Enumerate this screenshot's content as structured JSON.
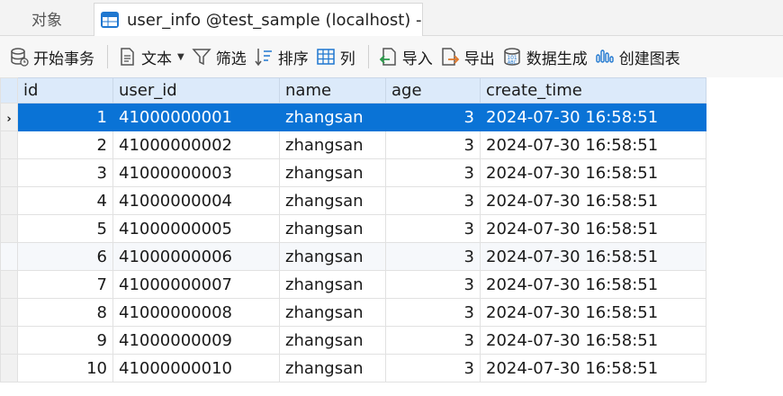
{
  "tabs": {
    "objects_label": "对象",
    "table_tab_label": "user_info @test_sample (localhost) -..."
  },
  "toolbar": {
    "begin_transaction": "开始事务",
    "text": "文本",
    "filter": "筛选",
    "sort": "排序",
    "columns": "列",
    "import": "导入",
    "export": "导出",
    "data_generation": "数据生成",
    "create_chart": "创建图表"
  },
  "grid": {
    "columns": [
      "id",
      "user_id",
      "name",
      "age",
      "create_time"
    ],
    "rows": [
      [
        "1",
        "41000000001",
        "zhangsan",
        "3",
        "2024-07-30 16:58:51"
      ],
      [
        "2",
        "41000000002",
        "zhangsan",
        "3",
        "2024-07-30 16:58:51"
      ],
      [
        "3",
        "41000000003",
        "zhangsan",
        "3",
        "2024-07-30 16:58:51"
      ],
      [
        "4",
        "41000000004",
        "zhangsan",
        "3",
        "2024-07-30 16:58:51"
      ],
      [
        "5",
        "41000000005",
        "zhangsan",
        "3",
        "2024-07-30 16:58:51"
      ],
      [
        "6",
        "41000000006",
        "zhangsan",
        "3",
        "2024-07-30 16:58:51"
      ],
      [
        "7",
        "41000000007",
        "zhangsan",
        "3",
        "2024-07-30 16:58:51"
      ],
      [
        "8",
        "41000000008",
        "zhangsan",
        "3",
        "2024-07-30 16:58:51"
      ],
      [
        "9",
        "41000000009",
        "zhangsan",
        "3",
        "2024-07-30 16:58:51"
      ],
      [
        "10",
        "41000000010",
        "zhangsan",
        "3",
        "2024-07-30 16:58:51"
      ]
    ],
    "selected_row": 0,
    "row_pointer": "›"
  },
  "colors": {
    "selection": "#0a73d6",
    "header_bg": "#dceafa",
    "icon_blue": "#1f77d0",
    "icon_orange": "#e0782a",
    "icon_green": "#2a9d4b"
  }
}
